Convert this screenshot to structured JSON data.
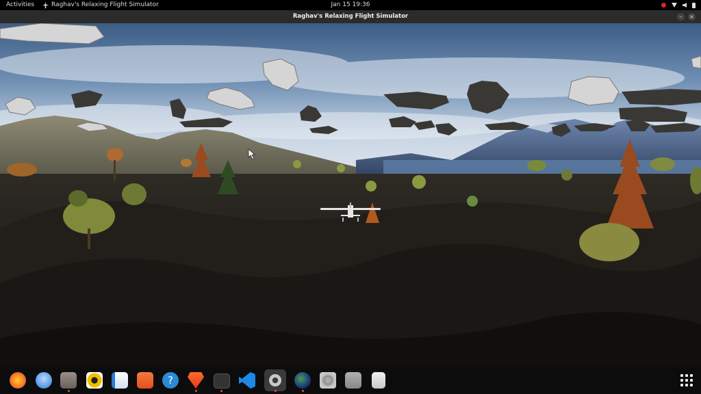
{
  "topbar": {
    "activities": "Activities",
    "app_name": "Raghav's Relaxing Flight Simulator",
    "clock": "Jan 15  19:36"
  },
  "window": {
    "title": "Raghav's Relaxing Flight Simulator"
  },
  "dock": {
    "items": [
      "firefox-icon",
      "thunderbird-icon",
      "files-icon",
      "rhythmbox-icon",
      "libreoffice-writer-icon",
      "app-center-icon",
      "help-icon",
      "brave-icon",
      "terminal-icon",
      "vscode-icon",
      "settings-icon",
      "flight-sim-icon",
      "disk-icon",
      "usb-drive-icon",
      "trash-icon"
    ]
  },
  "colors": {
    "topbar": "#000000",
    "titlebar": "#2b2b2b",
    "dock": "#0c0c0c",
    "accent": "#e95420"
  }
}
